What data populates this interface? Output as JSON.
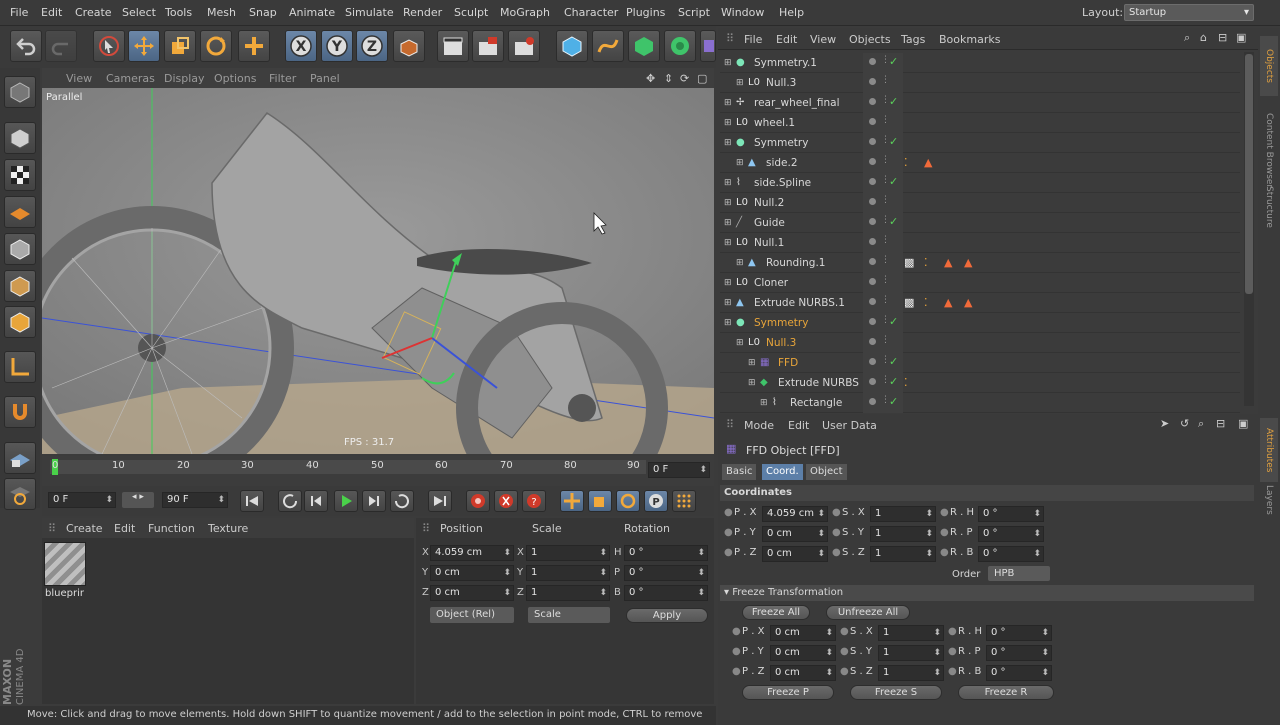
{
  "menubar": {
    "items": [
      "File",
      "Edit",
      "Create",
      "Select",
      "Tools",
      "Mesh",
      "Snap",
      "Animate",
      "Simulate",
      "Render",
      "Sculpt",
      "MoGraph",
      "Character",
      "Plugins",
      "Script",
      "Window",
      "Help"
    ],
    "layout_label": "Layout:",
    "layout_value": "Startup"
  },
  "toolbar": {
    "axis_x": "X",
    "axis_y": "Y",
    "axis_z": "Z"
  },
  "viewport": {
    "menu": [
      "View",
      "Cameras",
      "Display",
      "Options",
      "Filter",
      "Panel"
    ],
    "camera_label": "Parallel",
    "fps": "FPS : 31.7"
  },
  "timeline": {
    "ticks": [
      "0",
      "10",
      "20",
      "30",
      "40",
      "50",
      "60",
      "70",
      "80",
      "90"
    ],
    "current_frame": "0 F"
  },
  "transport": {
    "start_frame": "0 F",
    "end_frame": "90 F"
  },
  "materials": {
    "menu": [
      "Create",
      "Edit",
      "Function",
      "Texture"
    ],
    "item_label": "blueprir"
  },
  "coord_panel": {
    "headers": [
      "Position",
      "Scale",
      "Rotation"
    ],
    "rows": [
      {
        "axis": "X",
        "pos": "4.059 cm",
        "saxis": "X",
        "scale": "1",
        "raxis": "H",
        "rot": "0 °"
      },
      {
        "axis": "Y",
        "pos": "0 cm",
        "saxis": "Y",
        "scale": "1",
        "raxis": "P",
        "rot": "0 °"
      },
      {
        "axis": "Z",
        "pos": "0 cm",
        "saxis": "Z",
        "scale": "1",
        "raxis": "B",
        "rot": "0 °"
      }
    ],
    "mode": "Object (Rel)",
    "scale_mode": "Scale",
    "apply": "Apply"
  },
  "status": "Move: Click and drag to move elements. Hold down SHIFT to quantize movement / add to the selection in point mode, CTRL to remove",
  "brand": {
    "line1": "MAXON",
    "line2": "CINEMA 4D"
  },
  "object_manager": {
    "menu": [
      "File",
      "Edit",
      "View",
      "Objects",
      "Tags",
      "Bookmarks"
    ],
    "rows": [
      {
        "name": "Symmetry.1",
        "highlight": false
      },
      {
        "name": "Null.3",
        "highlight": false
      },
      {
        "name": "rear_wheel_final",
        "highlight": false
      },
      {
        "name": "wheel.1",
        "highlight": false
      },
      {
        "name": "Symmetry",
        "highlight": false
      },
      {
        "name": "side.2",
        "highlight": false
      },
      {
        "name": "side.Spline",
        "highlight": false
      },
      {
        "name": "Null.2",
        "highlight": false
      },
      {
        "name": "Guide",
        "highlight": false
      },
      {
        "name": "Null.1",
        "highlight": false
      },
      {
        "name": "Rounding.1",
        "highlight": false
      },
      {
        "name": "Cloner",
        "highlight": false
      },
      {
        "name": "Extrude NURBS.1",
        "highlight": false
      },
      {
        "name": "Symmetry",
        "highlight": true
      },
      {
        "name": "Null.3",
        "highlight": true
      },
      {
        "name": "FFD",
        "highlight": true
      },
      {
        "name": "Extrude NURBS",
        "highlight": false
      },
      {
        "name": "Rectangle",
        "highlight": false
      }
    ]
  },
  "side_tabs": [
    "Objects",
    "Content Browser",
    "Structure",
    "Attributes",
    "Layers"
  ],
  "attributes": {
    "menu": [
      "Mode",
      "Edit",
      "User Data"
    ],
    "title": "FFD Object [FFD]",
    "tabs": [
      "Basic",
      "Coord.",
      "Object"
    ],
    "section_coords": "Coordinates",
    "coords": [
      {
        "pl": "P . X",
        "pv": "4.059 cm",
        "sl": "S . X",
        "sv": "1",
        "rl": "R . H",
        "rv": "0 °"
      },
      {
        "pl": "P . Y",
        "pv": "0 cm",
        "sl": "S . Y",
        "sv": "1",
        "rl": "R . P",
        "rv": "0 °"
      },
      {
        "pl": "P . Z",
        "pv": "0 cm",
        "sl": "S . Z",
        "sv": "1",
        "rl": "R . B",
        "rv": "0 °"
      }
    ],
    "order_label": "Order",
    "order_value": "HPB",
    "section_freeze": "Freeze Transformation",
    "freeze_all": "Freeze All",
    "unfreeze_all": "Unfreeze All",
    "freeze": [
      {
        "pl": "P . X",
        "pv": "0 cm",
        "sl": "S . X",
        "sv": "1",
        "rl": "R . H",
        "rv": "0 °"
      },
      {
        "pl": "P . Y",
        "pv": "0 cm",
        "sl": "S . Y",
        "sv": "1",
        "rl": "R . P",
        "rv": "0 °"
      },
      {
        "pl": "P . Z",
        "pv": "0 cm",
        "sl": "S . Z",
        "sv": "1",
        "rl": "R . B",
        "rv": "0 °"
      }
    ],
    "freeze_p": "Freeze P",
    "freeze_s": "Freeze S",
    "freeze_r": "Freeze R"
  },
  "colors": {
    "accent": "#e8a53a",
    "selected": "#5c7fa8",
    "check": "#5ad15a"
  }
}
